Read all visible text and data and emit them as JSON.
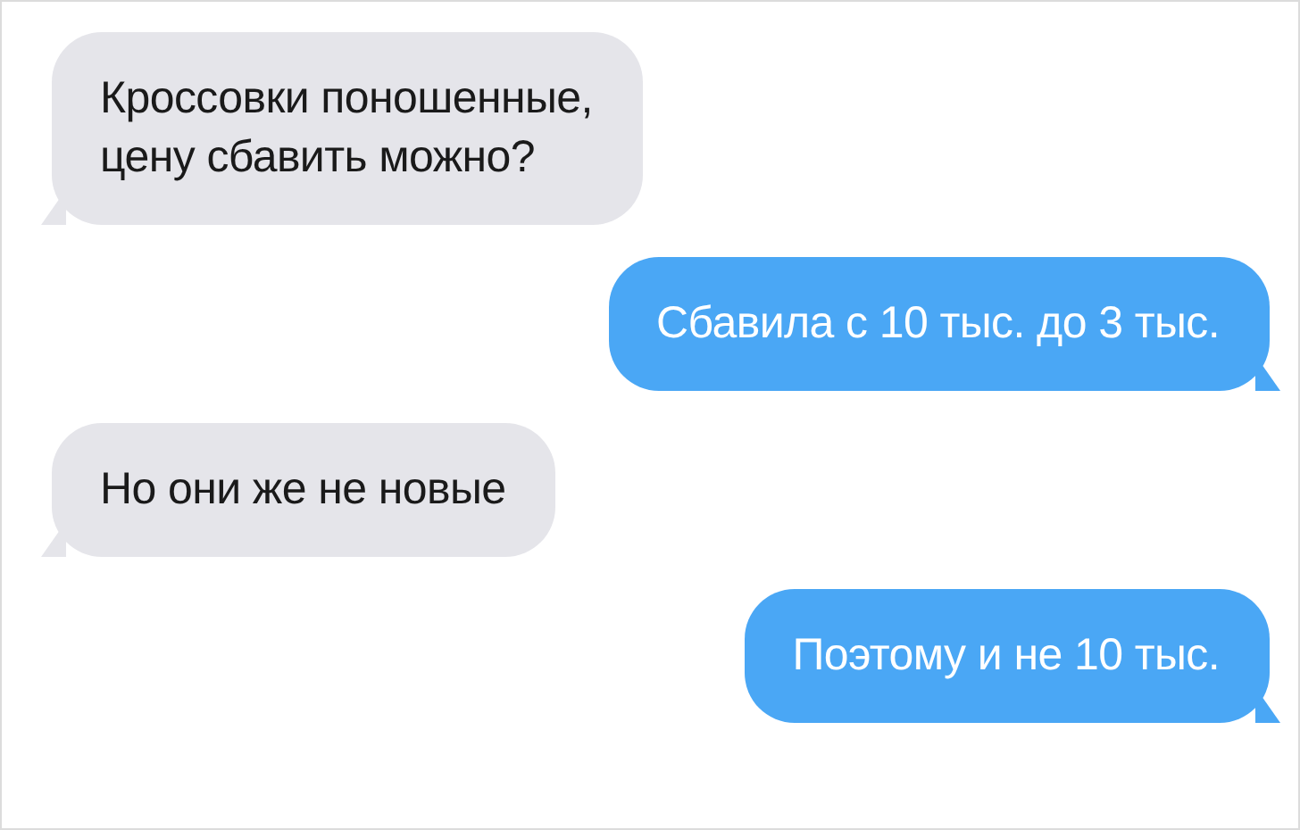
{
  "messages": [
    {
      "kind": "incoming",
      "text": "Кроссовки поношенные,\nцену сбавить можно?"
    },
    {
      "kind": "outgoing",
      "text": "Сбавила с 10 тыс. до 3 тыс."
    },
    {
      "kind": "incoming",
      "text": "Но они же не новые"
    },
    {
      "kind": "outgoing",
      "text": "Поэтому и не 10 тыс."
    }
  ]
}
